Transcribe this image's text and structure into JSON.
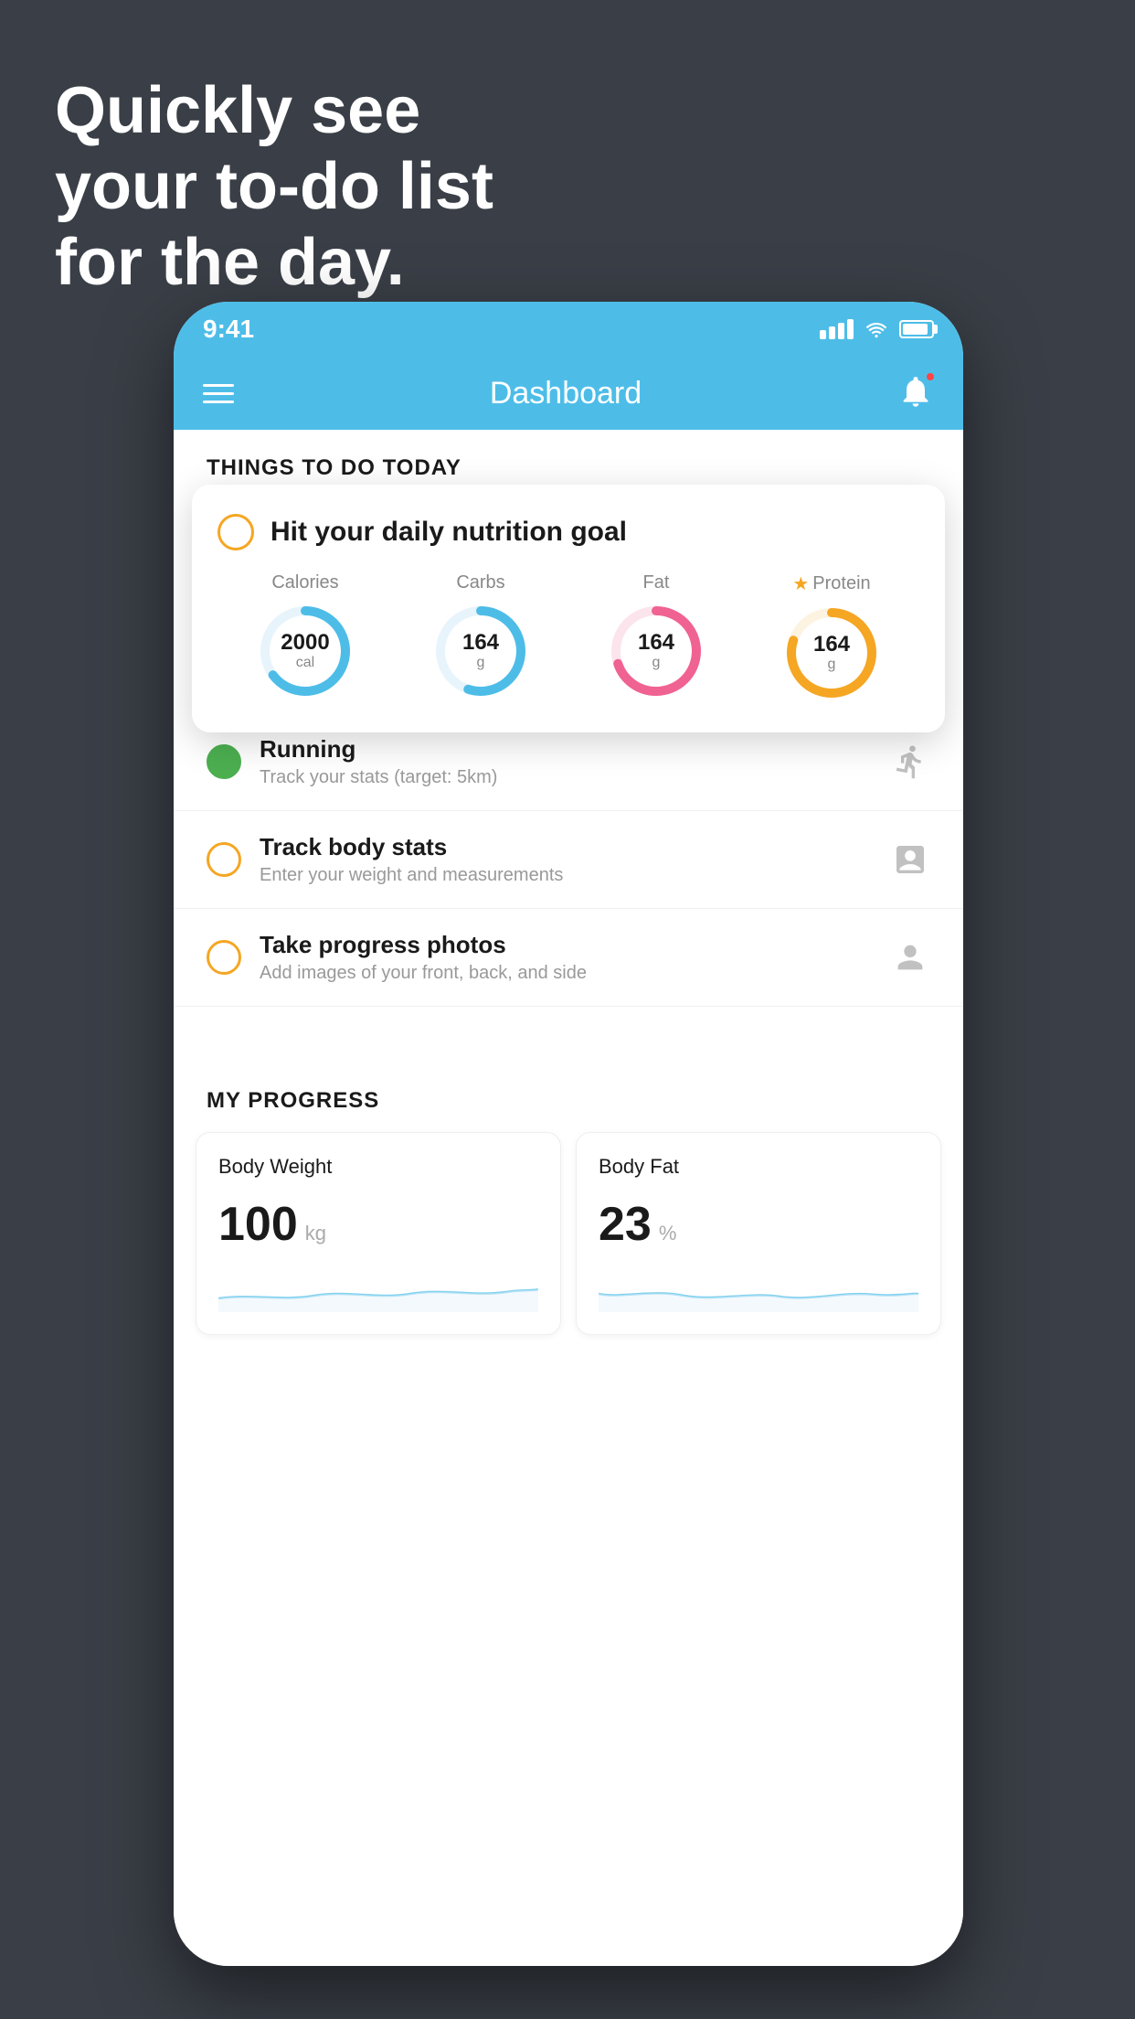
{
  "headline": {
    "line1": "Quickly see",
    "line2": "your to-do list",
    "line3": "for the day."
  },
  "statusBar": {
    "time": "9:41"
  },
  "navBar": {
    "title": "Dashboard"
  },
  "thingsSection": {
    "header": "THINGS TO DO TODAY"
  },
  "floatingCard": {
    "title": "Hit your daily nutrition goal",
    "items": [
      {
        "label": "Calories",
        "value": "2000",
        "unit": "cal",
        "color": "#4dbde8",
        "progress": 0.65,
        "star": false
      },
      {
        "label": "Carbs",
        "value": "164",
        "unit": "g",
        "color": "#4dbde8",
        "progress": 0.55,
        "star": false
      },
      {
        "label": "Fat",
        "value": "164",
        "unit": "g",
        "color": "#f06292",
        "progress": 0.7,
        "star": false
      },
      {
        "label": "Protein",
        "value": "164",
        "unit": "g",
        "color": "#f5a623",
        "progress": 0.8,
        "star": true
      }
    ]
  },
  "todoItems": [
    {
      "title": "Running",
      "subtitle": "Track your stats (target: 5km)",
      "circleColor": "green",
      "iconType": "shoe"
    },
    {
      "title": "Track body stats",
      "subtitle": "Enter your weight and measurements",
      "circleColor": "yellow",
      "iconType": "scale"
    },
    {
      "title": "Take progress photos",
      "subtitle": "Add images of your front, back, and side",
      "circleColor": "yellow",
      "iconType": "person"
    }
  ],
  "progressSection": {
    "header": "MY PROGRESS",
    "cards": [
      {
        "title": "Body Weight",
        "value": "100",
        "unit": "kg"
      },
      {
        "title": "Body Fat",
        "value": "23",
        "unit": "%"
      }
    ]
  }
}
